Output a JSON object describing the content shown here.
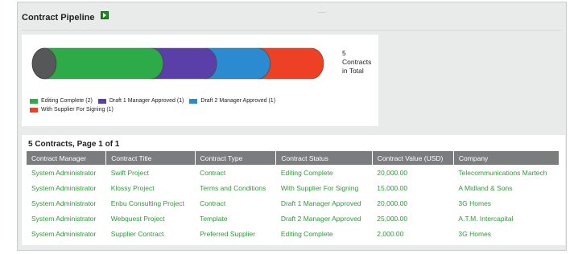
{
  "panel": {
    "title": "Contract Pipeline",
    "export_icon": "export-play-icon"
  },
  "chart_data": {
    "type": "bar",
    "orientation": "horizontal-stacked-cylinder",
    "categories": [
      "Editing Complete",
      "Draft 1 Manager Approved",
      "Draft 2 Manager Approved",
      "With Supplier For Signing"
    ],
    "values": [
      2,
      1,
      1,
      1
    ],
    "colors": [
      "#2eab49",
      "#5b3fa8",
      "#2a8bd1",
      "#ee4024"
    ],
    "total": 5,
    "legend_position": "bottom-left",
    "total_label_lines": [
      "5",
      "Contracts",
      "in Total"
    ],
    "legend": [
      {
        "label": "Editing Complete (2)",
        "color": "#2eab49"
      },
      {
        "label": "Draft 1 Manager Approved (1)",
        "color": "#5b3fa8"
      },
      {
        "label": "Draft 2 Manager Approved (1)",
        "color": "#2a8bd1"
      },
      {
        "label": "With Supplier For Signing (1)",
        "color": "#ee4024"
      }
    ]
  },
  "table": {
    "title": "5 Contracts, Page 1 of 1",
    "columns": [
      "Contract Manager",
      "Contract Title",
      "Contract Type",
      "Contract Status",
      "Contract Value (USD)",
      "Company"
    ],
    "rows": [
      [
        "System Administrator",
        "Swift Project",
        "Contract",
        "Editing Complete",
        "20,000.00",
        "Telecommunications Martech"
      ],
      [
        "System Administrator",
        "Klossy Project",
        "Terms and Conditions",
        "With Supplier For Signing",
        "15,000.00",
        "A Midland & Sons"
      ],
      [
        "System Administrator",
        "Enbu Consulting Project",
        "Contract",
        "Draft 1 Manager Approved",
        "20,000.00",
        "3G Homes"
      ],
      [
        "System Administrator",
        "Webquest Project",
        "Template",
        "Draft 2 Manager Approved",
        "25,000.00",
        "A.T.M. Intercapital"
      ],
      [
        "System Administrator",
        "Supplier Contract",
        "Preferred Supplier",
        "Editing Complete",
        "2,000.00",
        "3G Homes"
      ]
    ]
  }
}
